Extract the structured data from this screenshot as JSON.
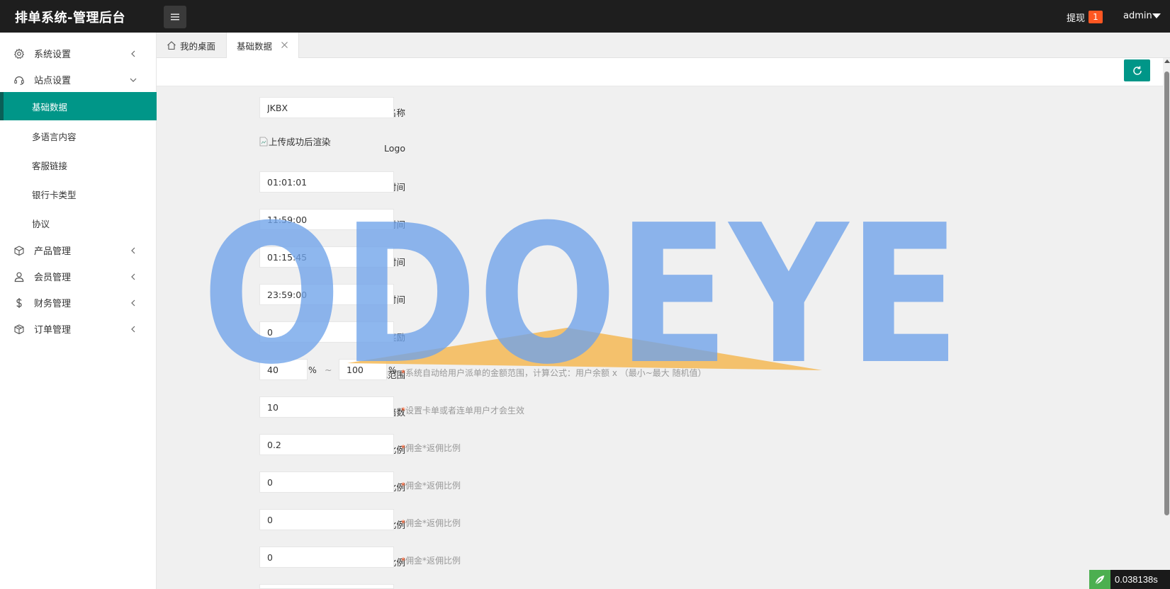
{
  "header": {
    "title": "排单系统-管理后台",
    "withdraw_label": "提现",
    "withdraw_count": "1",
    "user": "admin"
  },
  "sidebar": {
    "menus": [
      {
        "label": "系统设置",
        "icon": "gear-icon"
      },
      {
        "label": "站点设置",
        "icon": "headset-icon"
      }
    ],
    "sub_items": [
      "基础数据",
      "多语言内容",
      "客服链接",
      "银行卡类型",
      "协议"
    ],
    "menus_after": [
      {
        "label": "产品管理",
        "icon": "box-icon"
      },
      {
        "label": "会员管理",
        "icon": "user-icon"
      },
      {
        "label": "财务管理",
        "icon": "dollar-icon"
      },
      {
        "label": "订单管理",
        "icon": "package-icon"
      }
    ]
  },
  "tabs": {
    "home": "我的桌面",
    "active": "基础数据"
  },
  "form": {
    "app_name": {
      "label": "APP名称",
      "value": "JKBX"
    },
    "logo": {
      "label": "Logo",
      "alt": "上传成功后渲染"
    },
    "open_time": {
      "label": "开盘时间",
      "value": "01:01:01"
    },
    "close_time": {
      "label": "闭盘时间",
      "value": "11:59:00"
    },
    "withdraw_start": {
      "label": "提现-开始时间",
      "value": "01:15:45"
    },
    "withdraw_end": {
      "label": "提现-结束时间",
      "value": "23:59:00"
    },
    "register_reward": {
      "label": "注册奖励",
      "value": "0"
    },
    "match_range": {
      "label": "匹配范围",
      "min": "40",
      "max": "100",
      "unit": "%",
      "sep": "~",
      "hint": "系统自动给用户派单的金额范围，计算公式：用户余额 x （最小~最大 随机值）"
    },
    "commission_multiple": {
      "label": "返佣倍数",
      "value": "10",
      "hint": "设置卡单或者连单用户才会生效"
    },
    "level1": {
      "label": "一级返佣比例",
      "value": "0.2",
      "hint": "佣金*返佣比例"
    },
    "level2": {
      "label": "二级返佣比例",
      "value": "0",
      "hint": "佣金*返佣比例"
    },
    "level3": {
      "label": "三级返佣比例",
      "value": "0",
      "hint": "佣金*返佣比例"
    },
    "level4": {
      "label": "四级返佣比例",
      "value": "0",
      "hint": "佣金*返佣比例"
    },
    "required_mark": "*"
  },
  "watermark": "ODOEYE",
  "timing": "0.038138s",
  "colors": {
    "accent": "#009688",
    "header_bg": "#1e1e1e",
    "badge": "#ff5722",
    "watermark_blue": "#6fa3ea",
    "watermark_orange": "#f5b955"
  }
}
